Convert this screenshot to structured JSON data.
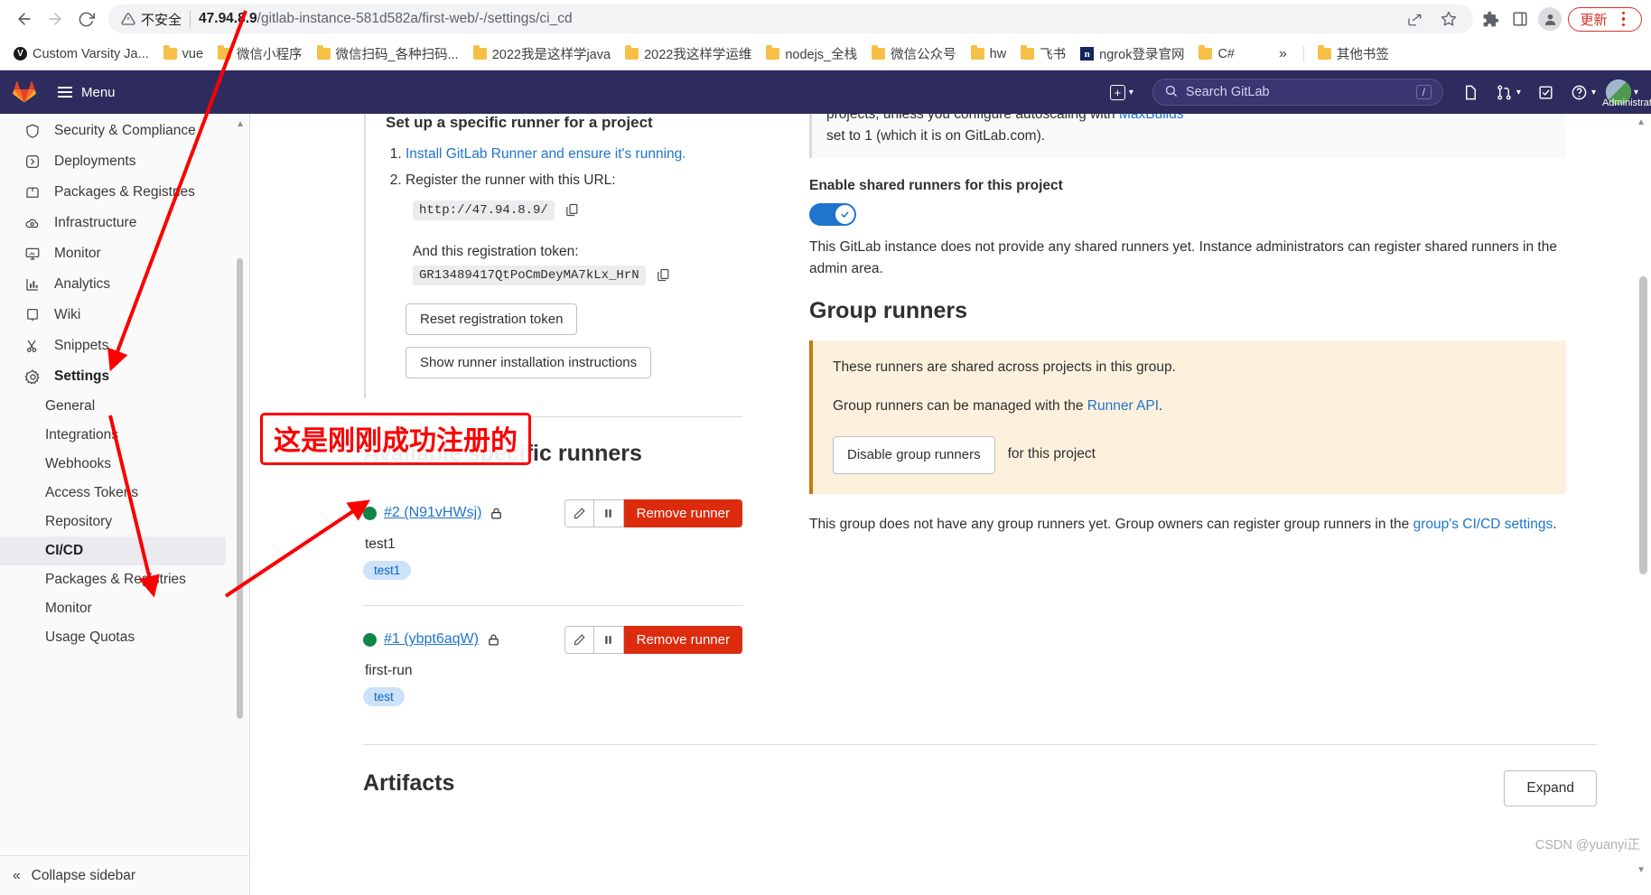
{
  "browser": {
    "back_label": "back",
    "forward_label": "forward",
    "reload_label": "reload",
    "not_secure": "不安全",
    "url_host": "47.94.8.9",
    "url_path": "/gitlab-instance-581d582a/first-web/-/settings/ci_cd",
    "update_label": "更新"
  },
  "bookmarks": {
    "items": [
      {
        "label": "Custom Varsity Ja...",
        "icon": "shield-icon"
      },
      {
        "label": "vue",
        "icon": "folder-icon"
      },
      {
        "label": "微信小程序",
        "icon": "folder-icon"
      },
      {
        "label": "微信扫码_各种扫码...",
        "icon": "folder-icon"
      },
      {
        "label": "2022我是这样学java",
        "icon": "folder-icon"
      },
      {
        "label": "2022我这样学运维",
        "icon": "folder-icon"
      },
      {
        "label": "nodejs_全栈",
        "icon": "folder-icon"
      },
      {
        "label": "微信公众号",
        "icon": "folder-icon"
      },
      {
        "label": "hw",
        "icon": "folder-icon"
      },
      {
        "label": "飞书",
        "icon": "folder-icon"
      },
      {
        "label": "ngrok登录官网",
        "icon": "ngrok-icon"
      },
      {
        "label": "C#",
        "icon": "folder-icon"
      }
    ],
    "overflow": "»",
    "other_label": "其他书签"
  },
  "gitlab_header": {
    "menu_label": "Menu",
    "search_placeholder": "Search GitLab",
    "search_shortcut": "/",
    "avatar_label": "Administrato"
  },
  "sidebar": {
    "items": [
      {
        "label": "Security & Compliance",
        "icon": "shield-icon"
      },
      {
        "label": "Deployments",
        "icon": "deploy-icon"
      },
      {
        "label": "Packages & Registries",
        "icon": "package-icon"
      },
      {
        "label": "Infrastructure",
        "icon": "cloud-gear-icon"
      },
      {
        "label": "Monitor",
        "icon": "monitor-icon"
      },
      {
        "label": "Analytics",
        "icon": "chart-icon"
      },
      {
        "label": "Wiki",
        "icon": "book-icon"
      },
      {
        "label": "Snippets",
        "icon": "scissors-icon"
      },
      {
        "label": "Settings",
        "icon": "gear-icon"
      }
    ],
    "sub_items": [
      {
        "label": "General",
        "active": false
      },
      {
        "label": "Integrations",
        "active": false
      },
      {
        "label": "Webhooks",
        "active": false
      },
      {
        "label": "Access Tokens",
        "active": false
      },
      {
        "label": "Repository",
        "active": false
      },
      {
        "label": "CI/CD",
        "active": true
      },
      {
        "label": "Packages & Registries",
        "active": false
      },
      {
        "label": "Monitor",
        "active": false
      },
      {
        "label": "Usage Quotas",
        "active": false
      }
    ],
    "collapse_label": "Collapse sidebar"
  },
  "specific_runner": {
    "heading": "Set up a specific runner for a project",
    "step1_link": "Install GitLab Runner and ensure it's running.",
    "step2_text": "Register the runner with this URL:",
    "url_value": "http://47.94.8.9/",
    "token_label": "And this registration token:",
    "token_value": "GR13489417QtPoCmDeyMA7kLx_HrN",
    "reset_button": "Reset registration token",
    "instructions_button": "Show runner installation instructions"
  },
  "available_runners": {
    "heading": "Available specific runners",
    "edit_label": "Edit runner",
    "pause_label": "Pause runner",
    "remove_label": "Remove runner",
    "runners": [
      {
        "id": "#2 (N91vHWsj)",
        "description": "test1",
        "tag": "test1",
        "status": "online"
      },
      {
        "id": "#1 (ybpt6aqW)",
        "description": "first-run",
        "tag": "test",
        "status": "online"
      }
    ]
  },
  "shared_runners": {
    "note_line1": "projects, unless you configure autoscaling with",
    "note_link": "MaxBuilds",
    "note_line2": "set to 1 (which it is on GitLab.com).",
    "toggle_label": "Enable shared runners for this project",
    "toggle_state": "on",
    "description": "This GitLab instance does not provide any shared runners yet. Instance administrators can register shared runners in the admin area."
  },
  "group_runners": {
    "heading": "Group runners",
    "alert_line1": "These runners are shared across projects in this group.",
    "alert_line2_prefix": "Group runners can be managed with the",
    "alert_line2_link": "Runner API",
    "disable_button": "Disable group runners",
    "disable_suffix": "for this project",
    "empty_prefix": "This group does not have any group runners yet. Group owners can register group runners in the",
    "empty_link": "group's CI/CD settings",
    "empty_suffix": "."
  },
  "artifacts": {
    "heading": "Artifacts",
    "expand_button": "Expand"
  },
  "annotations": {
    "callout_text": "这是刚刚成功注册的",
    "color": "#fa0000"
  },
  "watermark": "CSDN @yuanyi正",
  "colors": {
    "gitlab_navy": "#2e2c5e",
    "link_blue": "#1f75cb",
    "danger_red": "#dd2b0e",
    "success_green": "#108548",
    "warn_bg": "#fdf1dd",
    "warn_border": "#c17d10"
  }
}
